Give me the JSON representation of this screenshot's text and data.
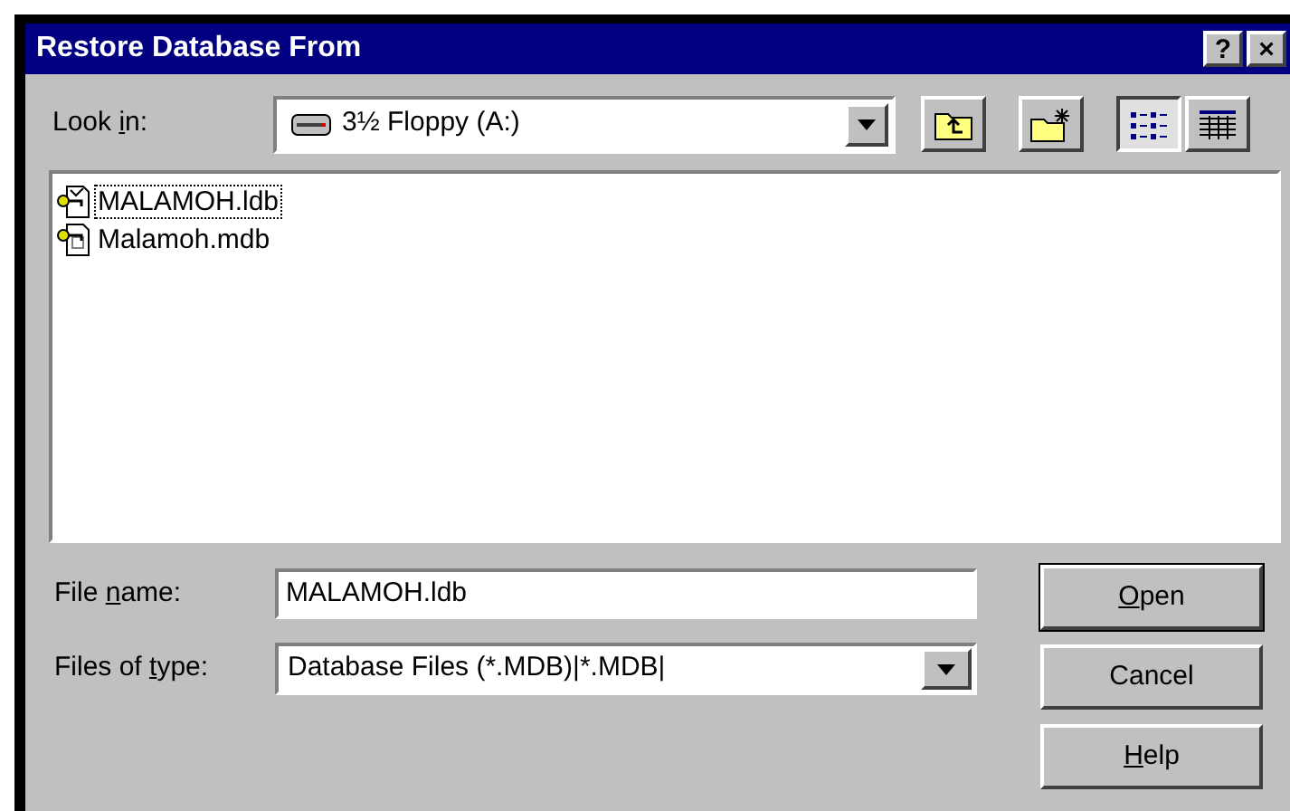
{
  "window": {
    "title": "Restore Database From",
    "title_buttons": [
      "?",
      "×"
    ]
  },
  "look_in": {
    "label": {
      "before": "Look ",
      "key": "i",
      "after": "n:"
    },
    "value": "3½ Floppy (A:)"
  },
  "toolbar": [
    {
      "kind": "up-folder",
      "selected": false
    },
    {
      "kind": "new-folder",
      "selected": false
    },
    {
      "kind": "list-view",
      "selected": true
    },
    {
      "kind": "details-view",
      "selected": false
    }
  ],
  "files": [
    {
      "name": "MALAMOH.ldb",
      "kind": "ldb",
      "selected": true
    },
    {
      "name": "Malamoh.mdb",
      "kind": "mdb",
      "selected": false
    }
  ],
  "file_name": {
    "label": {
      "before": "File ",
      "key": "n",
      "after": "ame:"
    },
    "value": "MALAMOH.ldb"
  },
  "files_of_type": {
    "label": {
      "before": "Files of ",
      "key": "t",
      "after": "ype:"
    },
    "value": "Database Files (*.MDB)|*.MDB|"
  },
  "buttons": [
    {
      "label": {
        "key": "O",
        "after": "pen"
      },
      "default": true
    },
    {
      "label": {
        "before": "Cancel"
      },
      "default": false
    },
    {
      "label": {
        "key": "H",
        "after": "elp"
      },
      "default": false
    }
  ]
}
